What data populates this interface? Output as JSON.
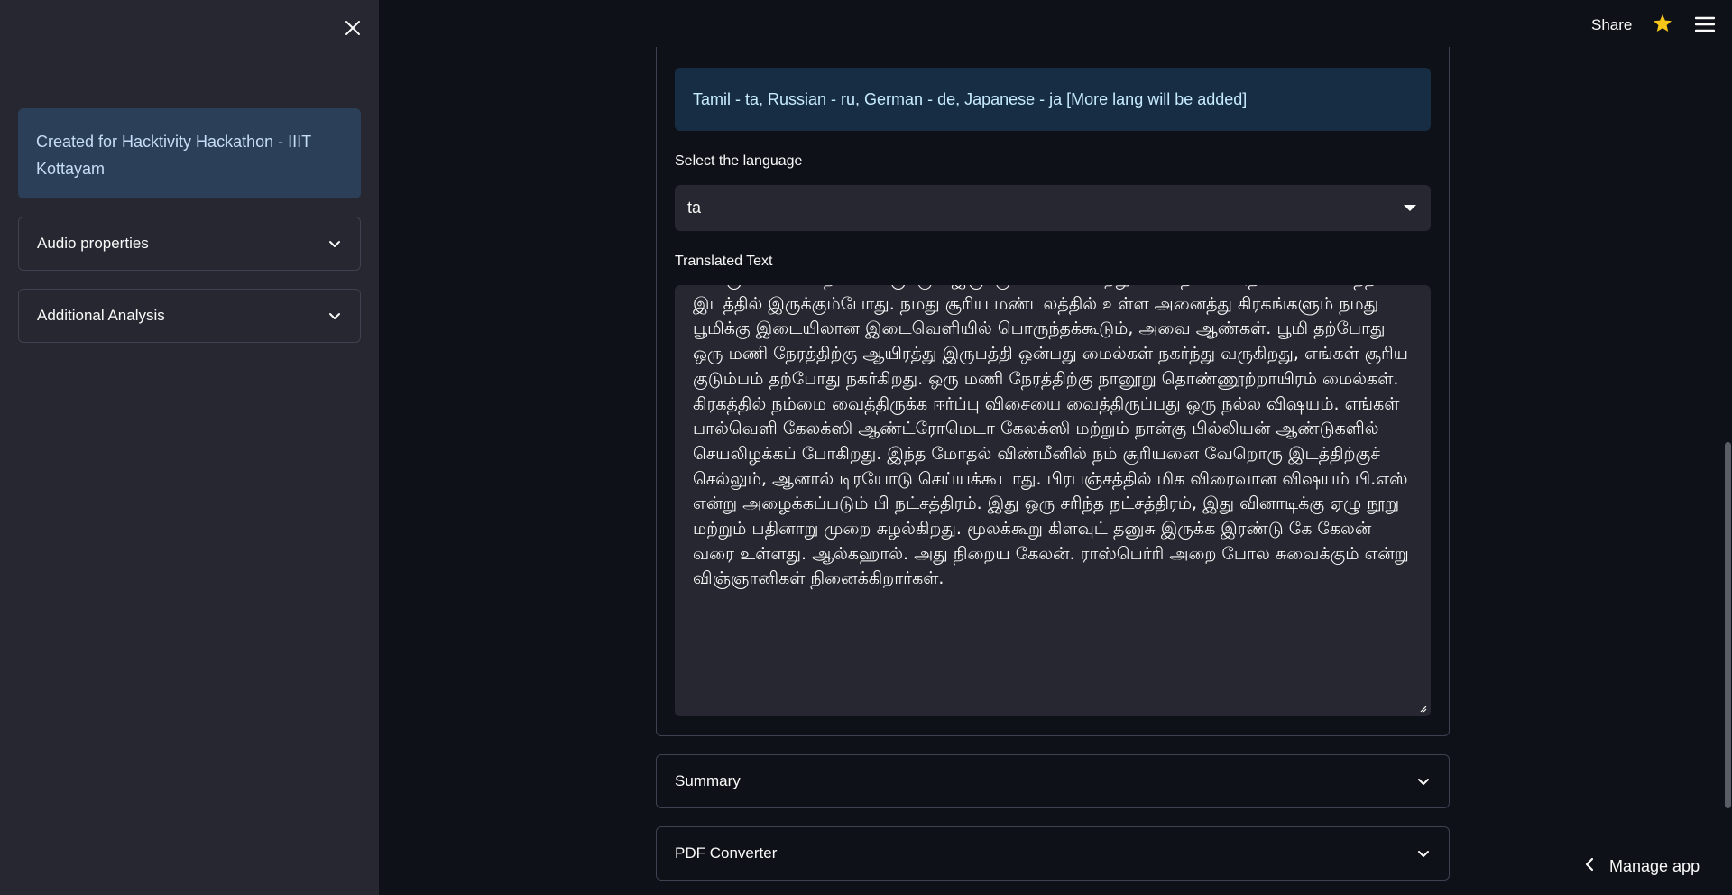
{
  "header": {
    "share_label": "Share",
    "star_icon": "star-icon",
    "menu_icon": "hamburger-menu-icon",
    "star_color": "#f5c518"
  },
  "sidebar": {
    "close_icon": "close-icon",
    "info_text": "Created for Hacktivity Hackathon - IIIT Kottayam",
    "expanders": [
      {
        "label": "Audio properties"
      },
      {
        "label": "Additional Analysis"
      }
    ]
  },
  "main": {
    "language_info": "Tamil - ta, Russian - ru, German - de, Japanese - ja [More lang will be added]",
    "select_label": "Select the language",
    "select_value": "ta",
    "translated_label": "Translated Text",
    "translated_text": "கொருள்ளவைப் நினைவிருக்கும் இருக்கும் உரிமை சுற்றுப்பாதையில் அதன் மிக உயர்ந்த இடத்தில் இருக்கும்போது. நமது சூரிய மண்டலத்தில் உள்ள அனைத்து கிரகங்களும் நமது பூமிக்கு இடையிலான இடைவெளியில் பொருந்தக்கூடும், அவை ஆண்கள். பூமி தற்போது ஒரு மணி நேரத்திற்கு ஆயிரத்து இருபத்தி ஒன்பது மைல்கள் நகர்ந்து வருகிறது, எங்கள் சூரிய குடும்பம் தற்போது நகர்கிறது. ஒரு மணி நேரத்திற்கு நானூறு தொண்ணூற்றாயிரம் மைல்கள். கிரகத்தில் நம்மை வைத்திருக்க ஈர்ப்பு விசையை வைத்திருப்பது ஒரு நல்ல விஷயம். எங்கள் பால்வெளி கேலக்ஸி ஆண்ட்ரோமெடா கேலக்ஸி மற்றும் நான்கு பில்லியன் ஆண்டுகளில் செயலிழக்கப் போகிறது. இந்த மோதல் விண்மீனில் நம் சூரியனை வேறொரு இடத்திற்குச் செல்லும், ஆனால் டிரயோடு செய்யக்கூடாது. பிரபஞ்சத்தில் மிக விரைவான விஷயம் பி.எஸ் என்று அழைக்கப்படும் பி நட்சத்திரம். இது ஒரு சரிந்த நட்சத்திரம், இது வினாடிக்கு ஏழு நூறு மற்றும் பதினாறு முறை சுழல்கிறது. மூலக்கூறு கிளவுட் தனுசு இருக்க இரண்டு கே கேலன் வரை உள்ளது. ஆல்கஹால். அது நிறைய கேலன். ராஸ்பெர்ரி அறை போல சுவைக்கும் என்று விஞ்ஞானிகள் நினைக்கிறார்கள்.",
    "expanders": [
      {
        "label": "Summary"
      },
      {
        "label": "PDF Converter"
      }
    ]
  },
  "footer": {
    "manage_label": "Manage app",
    "back_icon": "chevron-left-icon"
  }
}
